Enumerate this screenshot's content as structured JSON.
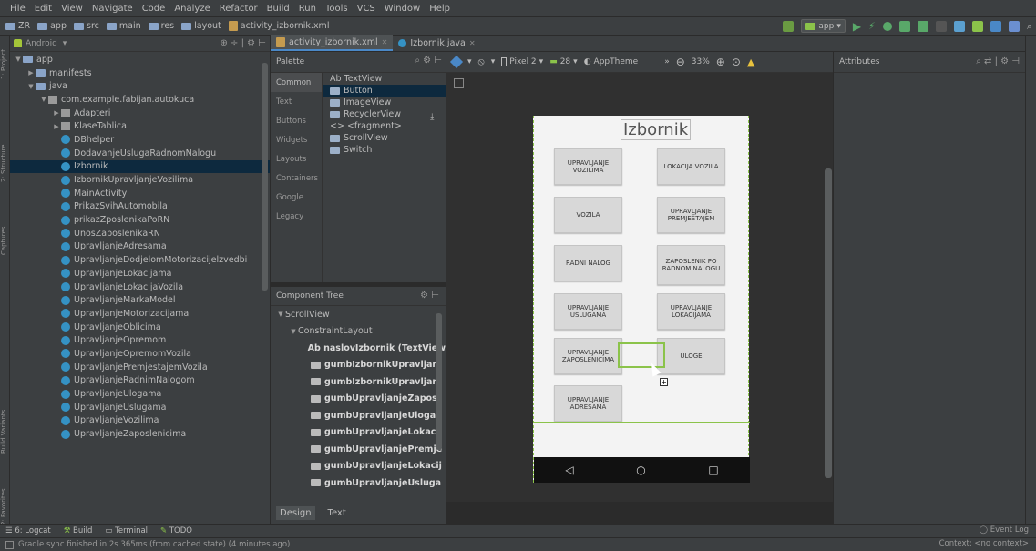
{
  "menu": [
    "File",
    "Edit",
    "View",
    "Navigate",
    "Code",
    "Analyze",
    "Refactor",
    "Build",
    "Run",
    "Tools",
    "VCS",
    "Window",
    "Help"
  ],
  "breadcrumbs": [
    "ZR",
    "app",
    "src",
    "main",
    "res",
    "layout",
    "activity_izbornik.xml"
  ],
  "run_config": "app",
  "project_view": "Android",
  "tree": [
    {
      "label": "app",
      "indent": 0,
      "arrow": "▼",
      "kind": "folder"
    },
    {
      "label": "manifests",
      "indent": 1,
      "arrow": "▶",
      "kind": "folder"
    },
    {
      "label": "java",
      "indent": 1,
      "arrow": "▼",
      "kind": "folder"
    },
    {
      "label": "com.example.fabijan.autokuca",
      "indent": 2,
      "arrow": "▼",
      "kind": "pkg"
    },
    {
      "label": "Adapteri",
      "indent": 3,
      "arrow": "▶",
      "kind": "pkg"
    },
    {
      "label": "KlaseTablica",
      "indent": 3,
      "arrow": "▶",
      "kind": "pkg"
    },
    {
      "label": "DBhelper",
      "indent": 3,
      "arrow": "",
      "kind": "class"
    },
    {
      "label": "DodavanjeUslugaRadnomNalogu",
      "indent": 3,
      "arrow": "",
      "kind": "class"
    },
    {
      "label": "Izbornik",
      "indent": 3,
      "arrow": "",
      "kind": "class",
      "selected": true
    },
    {
      "label": "IzbornikUpravljanjeVozilima",
      "indent": 3,
      "arrow": "",
      "kind": "class"
    },
    {
      "label": "MainActivity",
      "indent": 3,
      "arrow": "",
      "kind": "class"
    },
    {
      "label": "PrikazSvihAutomobila",
      "indent": 3,
      "arrow": "",
      "kind": "class"
    },
    {
      "label": "prikazZposlenikaPoRN",
      "indent": 3,
      "arrow": "",
      "kind": "class"
    },
    {
      "label": "UnosZaposlenikaRN",
      "indent": 3,
      "arrow": "",
      "kind": "class"
    },
    {
      "label": "UpravljanjeAdresama",
      "indent": 3,
      "arrow": "",
      "kind": "class"
    },
    {
      "label": "UpravljanjeDodjelomMotorizacijelzvedbi",
      "indent": 3,
      "arrow": "",
      "kind": "class"
    },
    {
      "label": "UpravljanjeLokacijama",
      "indent": 3,
      "arrow": "",
      "kind": "class"
    },
    {
      "label": "UpravljanjeLokacijaVozila",
      "indent": 3,
      "arrow": "",
      "kind": "class"
    },
    {
      "label": "UpravljanjeMarkaModel",
      "indent": 3,
      "arrow": "",
      "kind": "class"
    },
    {
      "label": "UpravljanjeMotorizacijama",
      "indent": 3,
      "arrow": "",
      "kind": "class"
    },
    {
      "label": "UpravljanjeOblicima",
      "indent": 3,
      "arrow": "",
      "kind": "class"
    },
    {
      "label": "UpravljanjeOpremom",
      "indent": 3,
      "arrow": "",
      "kind": "class"
    },
    {
      "label": "UpravljanjeOpremomVozila",
      "indent": 3,
      "arrow": "",
      "kind": "class"
    },
    {
      "label": "UpravljanjePremjestajemVozila",
      "indent": 3,
      "arrow": "",
      "kind": "class"
    },
    {
      "label": "UpravljanjeRadnimNalogom",
      "indent": 3,
      "arrow": "",
      "kind": "class"
    },
    {
      "label": "UpravljanjeUlogama",
      "indent": 3,
      "arrow": "",
      "kind": "class"
    },
    {
      "label": "UpravljanjeUslugama",
      "indent": 3,
      "arrow": "",
      "kind": "class"
    },
    {
      "label": "UpravljanjeVozilima",
      "indent": 3,
      "arrow": "",
      "kind": "class"
    },
    {
      "label": "UpravljanjeZaposlenicima",
      "indent": 3,
      "arrow": "",
      "kind": "class"
    }
  ],
  "tabs": [
    {
      "label": "activity_izbornik.xml",
      "active": true
    },
    {
      "label": "Izbornik.java",
      "active": false
    }
  ],
  "palette": {
    "title": "Palette",
    "categories": [
      "Common",
      "Text",
      "Buttons",
      "Widgets",
      "Layouts",
      "Containers",
      "Google",
      "Legacy"
    ],
    "items": [
      "Ab TextView",
      "Button",
      "ImageView",
      "RecyclerView",
      "<> <fragment>",
      "ScrollView",
      "Switch"
    ],
    "selected_item": 1
  },
  "component_tree": {
    "title": "Component Tree",
    "rows": [
      {
        "label": "ScrollView",
        "indent": 0,
        "arrow": "▼",
        "bold": false
      },
      {
        "label": "ConstraintLayout",
        "indent": 1,
        "arrow": "▼",
        "bold": false
      },
      {
        "label": "Ab naslovIzbornik (TextView",
        "indent": 2,
        "arrow": "",
        "bold": true
      },
      {
        "label": "gumbIzbornikUpravljanj",
        "indent": 2,
        "arrow": "",
        "bold": true
      },
      {
        "label": "gumbIzbornikUpravljanj",
        "indent": 2,
        "arrow": "",
        "bold": true
      },
      {
        "label": "gumbUpravljanjeZaposl",
        "indent": 2,
        "arrow": "",
        "bold": true
      },
      {
        "label": "gumbUpravljanjeUlogan",
        "indent": 2,
        "arrow": "",
        "bold": true
      },
      {
        "label": "gumbUpravljanjeLokacij",
        "indent": 2,
        "arrow": "",
        "bold": true
      },
      {
        "label": "gumbUpravljanjePremje",
        "indent": 2,
        "arrow": "",
        "bold": true
      },
      {
        "label": "gumbUpravljanjeLokacij",
        "indent": 2,
        "arrow": "",
        "bold": true
      },
      {
        "label": "gumbUpravljanjeUsluga",
        "indent": 2,
        "arrow": "",
        "bold": true
      }
    ]
  },
  "design_tabs": [
    "Design",
    "Text"
  ],
  "editor_toolbar": {
    "device": "Pixel 2",
    "api": "28",
    "theme": "AppTheme",
    "zoom": "33%"
  },
  "attributes_title": "Attributes",
  "phone": {
    "title": "Izbornik",
    "buttons": [
      "UPRAVLJANJE VOZILIMA",
      "LOKACIJA VOZILA",
      "VOZILA",
      "UPRAVLJANJE PREMJEŠTAJEM",
      "RADNI NALOG",
      "ZAPOSLENIK PO RADNOM NALOGU",
      "UPRAVLJANJE USLUGAMA",
      "UPRAVLJANJE LOKACIJAMA",
      "UPRAVLJANJE ZAPOSLENICIMA",
      "ULOGE",
      "UPRAVLJANJE ADRESAMA"
    ]
  },
  "bottom_tools": [
    "6: Logcat",
    "Build",
    "Terminal",
    "TODO"
  ],
  "event_log": "Event Log",
  "status": "Gradle sync finished in 2s 365ms (from cached state) (4 minutes ago)",
  "status_right": "Context: <no context>",
  "left_vtabs": [
    "1: Project",
    "2: Structure",
    "Captures",
    "Build Variants",
    "2: Favorites"
  ]
}
